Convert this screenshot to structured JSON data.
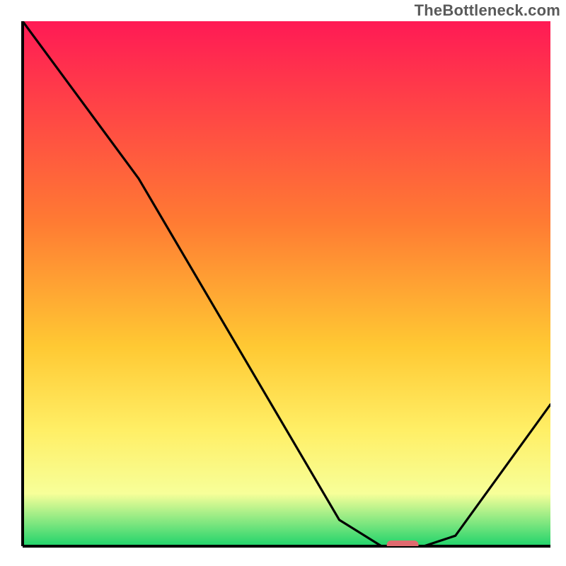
{
  "attribution": "TheBottleneck.com",
  "colors": {
    "gradient_top": "#ff1a55",
    "gradient_mid1": "#ff7a33",
    "gradient_mid2": "#ffc933",
    "gradient_mid3": "#ffef66",
    "gradient_mid4": "#f7ff99",
    "gradient_bottom": "#1fd36b",
    "line": "#000000",
    "frame": "#000000",
    "marker_fill": "#e06a6f",
    "marker_stroke": "#d45a60"
  },
  "chart_data": {
    "type": "line",
    "title": "",
    "xlabel": "",
    "ylabel": "",
    "xlim": [
      0,
      100
    ],
    "ylim": [
      0,
      100
    ],
    "x": [
      0,
      22,
      60,
      68,
      76,
      82,
      100
    ],
    "values": [
      100,
      70,
      5,
      0,
      0,
      2,
      27
    ],
    "marker": {
      "x": 72,
      "y": 0,
      "width": 6
    },
    "annotations": [],
    "legend": []
  }
}
